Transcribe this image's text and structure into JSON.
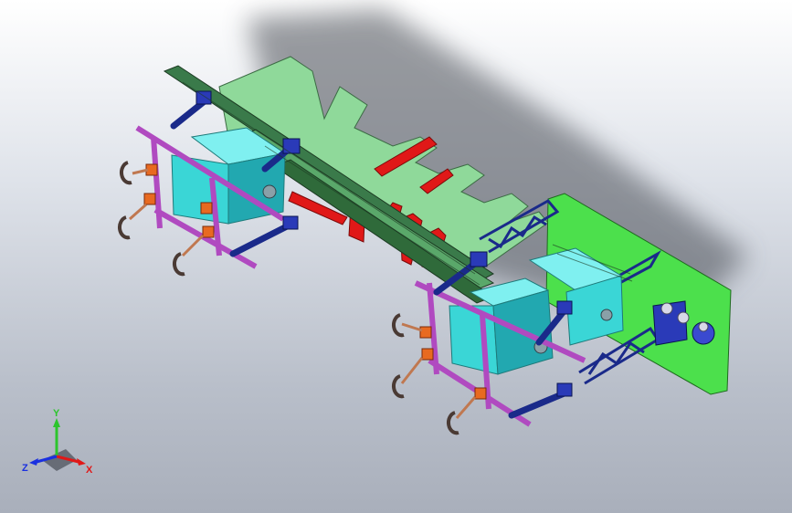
{
  "viewport": {
    "background_top": "#ffffff",
    "background_bottom": "#a9afbb"
  },
  "model_colors": {
    "green_panel": "#8fd99a",
    "red_block": "#e01818",
    "dark_rail": "#2a6a3a",
    "navy_arm": "#1a2a8a",
    "magenta_frame": "#b04ac0",
    "cyan_box": "#3ad6d6",
    "orange_part": "#e86a20",
    "bright_green_plate": "#4ce04c"
  },
  "triad": {
    "y_label": "Y",
    "x_label": "X",
    "z_label": "Z",
    "y_color": "#2cc52c",
    "x_color": "#e01818",
    "z_color": "#1a30e0"
  }
}
